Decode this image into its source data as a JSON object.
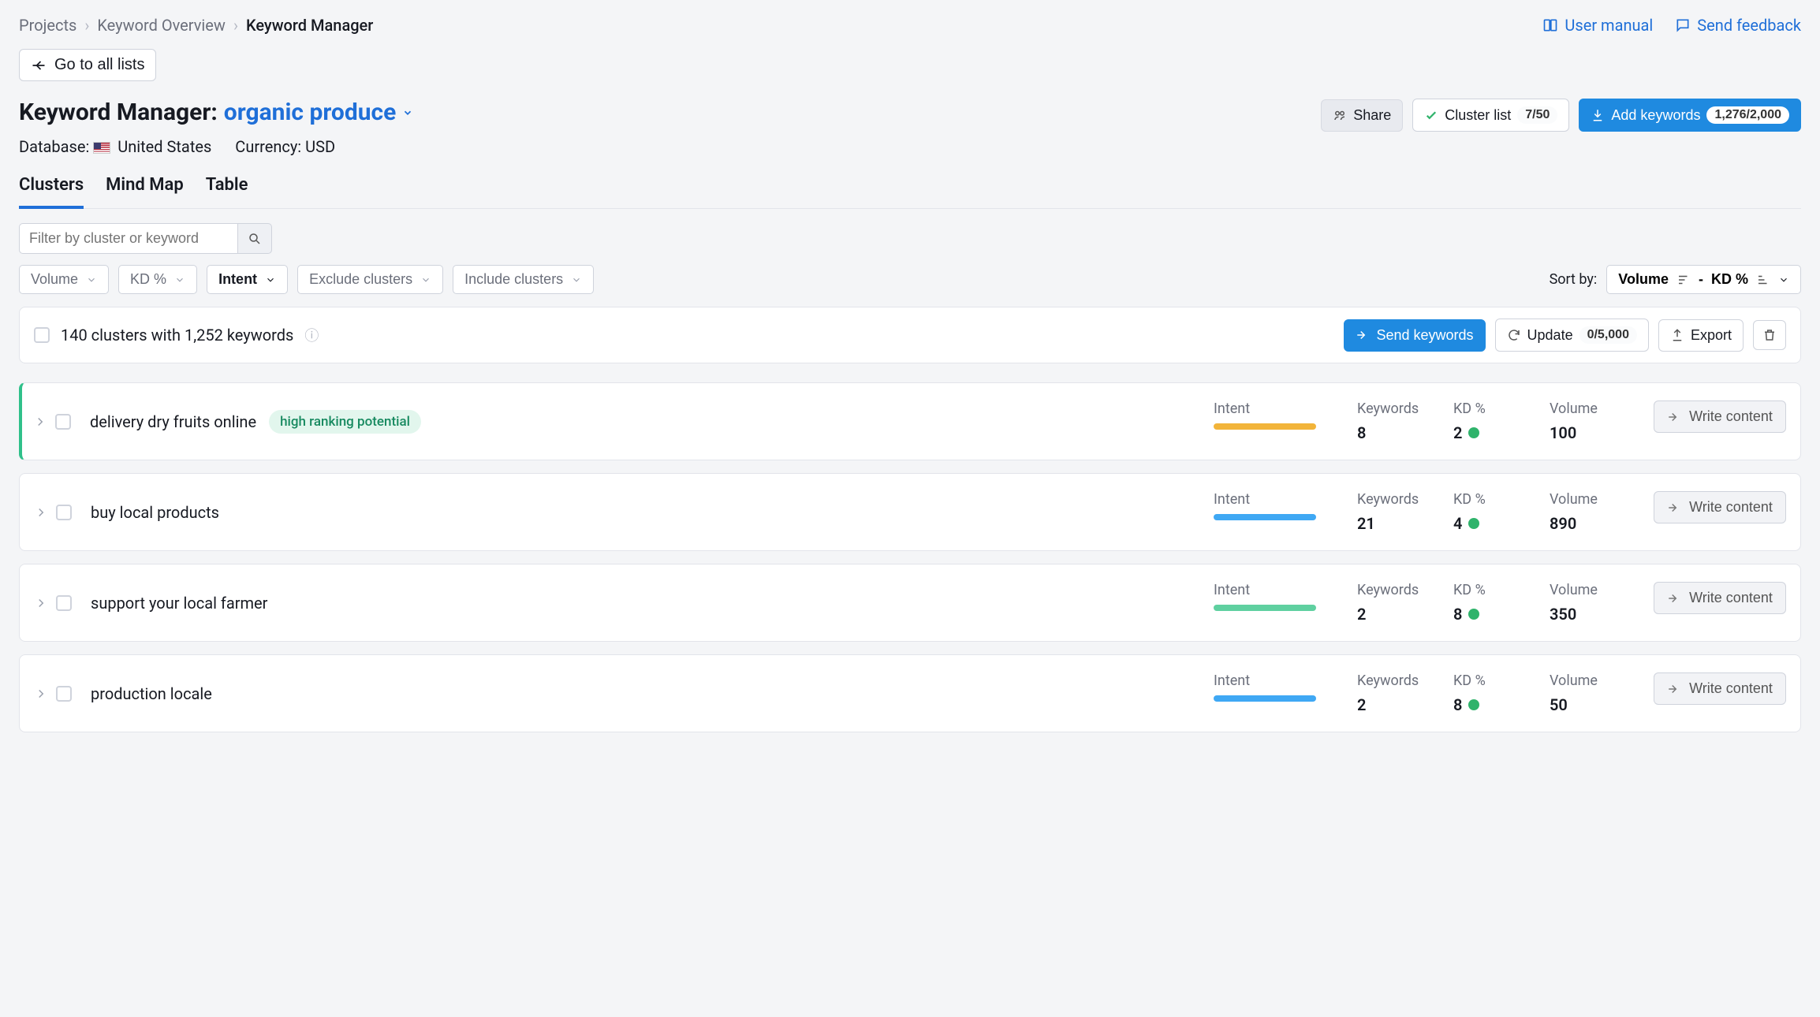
{
  "breadcrumbs": {
    "items": [
      "Projects",
      "Keyword Overview",
      "Keyword Manager"
    ]
  },
  "top_links": {
    "manual": "User manual",
    "feedback": "Send feedback"
  },
  "go_to_lists": "Go to all lists",
  "header": {
    "title_prefix": "Keyword Manager:",
    "list_name": "organic produce",
    "database_label": "Database:",
    "database_value": "United States",
    "currency_label": "Currency:",
    "currency_value": "USD"
  },
  "actions": {
    "share": "Share",
    "cluster_list": "Cluster list",
    "cluster_count": "7/50",
    "add_keywords": "Add keywords",
    "keyword_count": "1,276/2,000"
  },
  "tabs": [
    "Clusters",
    "Mind Map",
    "Table"
  ],
  "filter": {
    "placeholder": "Filter by cluster or keyword",
    "volume": "Volume",
    "kd": "KD %",
    "intent": "Intent",
    "exclude": "Exclude clusters",
    "include": "Include clusters"
  },
  "sort": {
    "label": "Sort by:",
    "primary": "Volume",
    "separator": "-",
    "secondary": "KD %"
  },
  "summary": {
    "text": "140 clusters with 1,252 keywords",
    "send": "Send keywords",
    "update": "Update",
    "update_count": "0/5,000",
    "export": "Export"
  },
  "metric_labels": {
    "intent": "Intent",
    "keywords": "Keywords",
    "kd": "KD %",
    "volume": "Volume"
  },
  "write_content": "Write content",
  "clusters": [
    {
      "name": "delivery dry fruits online",
      "badge": "high ranking potential",
      "intent_color": "yellow",
      "keywords": "8",
      "kd": "2",
      "volume": "100",
      "highlight": true
    },
    {
      "name": "buy local products",
      "badge": null,
      "intent_color": "blue",
      "keywords": "21",
      "kd": "4",
      "volume": "890",
      "highlight": false
    },
    {
      "name": "support your local farmer",
      "badge": null,
      "intent_color": "green",
      "keywords": "2",
      "kd": "8",
      "volume": "350",
      "highlight": false
    },
    {
      "name": "production locale",
      "badge": null,
      "intent_color": "blue",
      "keywords": "2",
      "kd": "8",
      "volume": "50",
      "highlight": false
    }
  ]
}
